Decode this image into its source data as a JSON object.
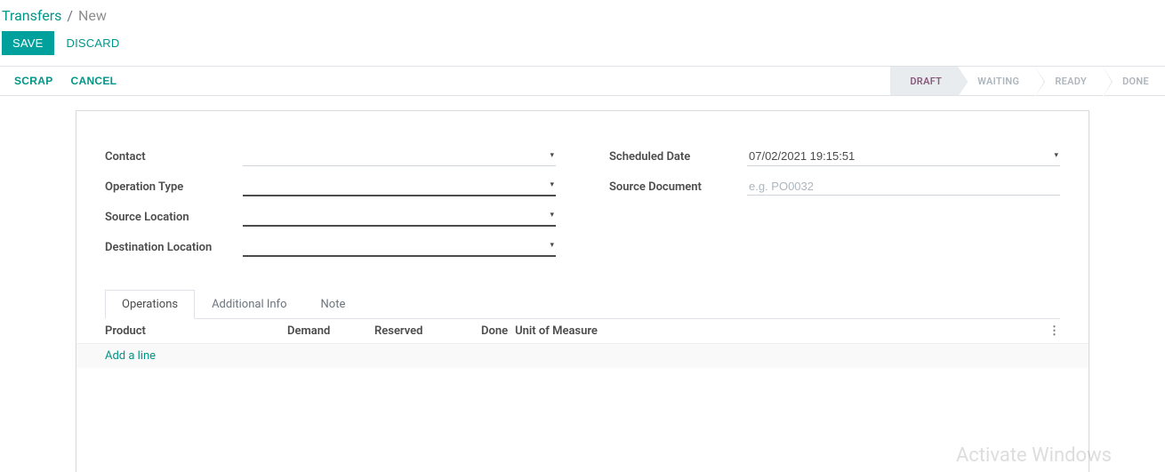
{
  "breadcrumb": {
    "root": "Transfers",
    "sep": "/",
    "current": "New"
  },
  "actions": {
    "save": "SAVE",
    "discard": "DISCARD"
  },
  "status_actions": {
    "scrap": "SCRAP",
    "cancel": "CANCEL"
  },
  "stages": {
    "draft": "DRAFT",
    "waiting": "WAITING",
    "ready": "READY",
    "done": "DONE"
  },
  "form": {
    "contact_label": "Contact",
    "operation_type_label": "Operation Type",
    "source_location_label": "Source Location",
    "destination_location_label": "Destination Location",
    "scheduled_date_label": "Scheduled Date",
    "scheduled_date_value": "07/02/2021 19:15:51",
    "source_document_label": "Source Document",
    "source_document_placeholder": "e.g. PO0032"
  },
  "tabs": {
    "operations": "Operations",
    "additional_info": "Additional Info",
    "note": "Note"
  },
  "table": {
    "headers": {
      "product": "Product",
      "demand": "Demand",
      "reserved": "Reserved",
      "done": "Done",
      "uom": "Unit of Measure"
    },
    "add_line": "Add a line"
  },
  "watermark": "Activate Windows"
}
